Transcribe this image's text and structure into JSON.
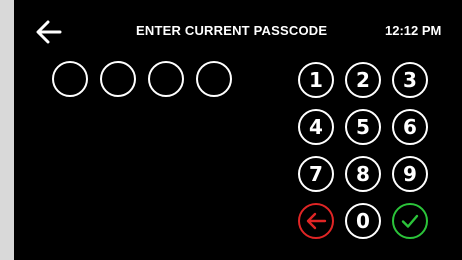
{
  "header": {
    "title": "ENTER CURRENT PASSCODE",
    "time": "12:12 PM",
    "back_icon": "arrow-left-icon"
  },
  "passcode": {
    "length": 4,
    "entered": 0
  },
  "keypad": {
    "keys": [
      "1",
      "2",
      "3",
      "4",
      "5",
      "6",
      "7",
      "8",
      "9",
      "0"
    ],
    "delete_icon": "arrow-left-icon",
    "enter_icon": "checkmark-icon"
  },
  "colors": {
    "background": "#000000",
    "foreground": "#ffffff",
    "delete": "#e02525",
    "enter": "#2bc43a",
    "frame": "#d9d9d9"
  }
}
